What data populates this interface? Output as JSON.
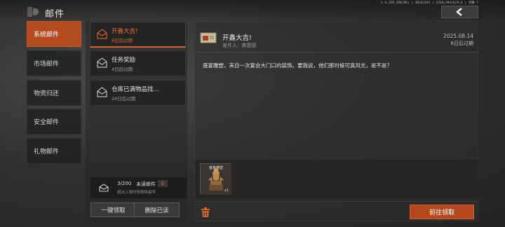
{
  "header": {
    "title": "邮件",
    "version": "1.4.159.158(96) | 3814|641 | 1314|394|6|9,6 | 点数-7"
  },
  "categories": [
    {
      "label": "系统邮件",
      "active": true
    },
    {
      "label": "市场邮件",
      "active": false
    },
    {
      "label": "物资归还",
      "active": false
    },
    {
      "label": "安全邮件",
      "active": false
    },
    {
      "label": "礼物邮件",
      "active": false
    }
  ],
  "mails": [
    {
      "title": "开鑫大吉!",
      "expiry": "6日后过期",
      "active": true
    },
    {
      "title": "任务奖励",
      "expiry": "4日后过期",
      "active": false
    },
    {
      "title": "仓库已满物品找...",
      "expiry": "26日后过期",
      "active": false
    }
  ],
  "counter": {
    "count": "3/200",
    "unread_label": "未读邮件",
    "unread": "0",
    "hint": "超出上限时将删除最早"
  },
  "actions": {
    "claim_all": "一键领取",
    "delete_read": "删除已读"
  },
  "detail": {
    "title": "开鑫大吉!",
    "sender_label": "发件人:",
    "sender": "弗恩德",
    "date": "2025.08.14",
    "expiry": "6日后过期",
    "body": "盛宴雕塑，来自一次宴会大门口的装饰。要我说，他们那时候可真风光，是不是?",
    "attachment": {
      "name": "盛宴雕塑",
      "count": "x1"
    },
    "claim_button": "前往领取"
  },
  "colors": {
    "accent": "#b44b20",
    "accent_text": "#e7743c"
  }
}
